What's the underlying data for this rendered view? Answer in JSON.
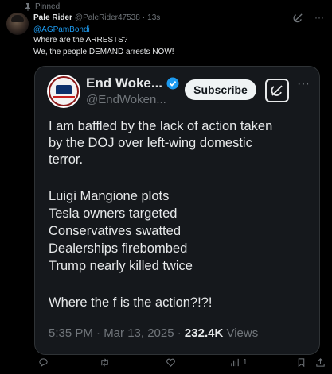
{
  "pinned_label": "Pinned",
  "post": {
    "author_name": "Pale Rider",
    "author_handle": "@PaleRider47538",
    "dot": "·",
    "time": "13s",
    "mention": "@AGPamBondi",
    "lines": [
      "Where are the ARRESTS?",
      "We, the people DEMAND arrests NOW!"
    ],
    "more": "···"
  },
  "quote": {
    "name": "End Woke...",
    "handle": "@EndWoken...",
    "subscribe_label": "Subscribe",
    "more": "···",
    "text_lines": [
      "I am baffled by the lack of action taken",
      "by the DOJ over left-wing domestic",
      "terror.",
      "Luigi Mangione plots",
      "Tesla owners targeted",
      "Conservatives swatted",
      "Dealerships firebombed",
      "Trump nearly killed twice",
      "Where the f is the action?!?!"
    ],
    "timestamp": "5:35 PM · Mar 13, 2025 ·",
    "views_count": "232.4K",
    "views_label": "Views"
  },
  "actions": {
    "views_count": "1"
  },
  "colors": {
    "accent": "#1d9bf0",
    "background": "#000000",
    "card": "#15181c",
    "muted": "#71767b"
  }
}
